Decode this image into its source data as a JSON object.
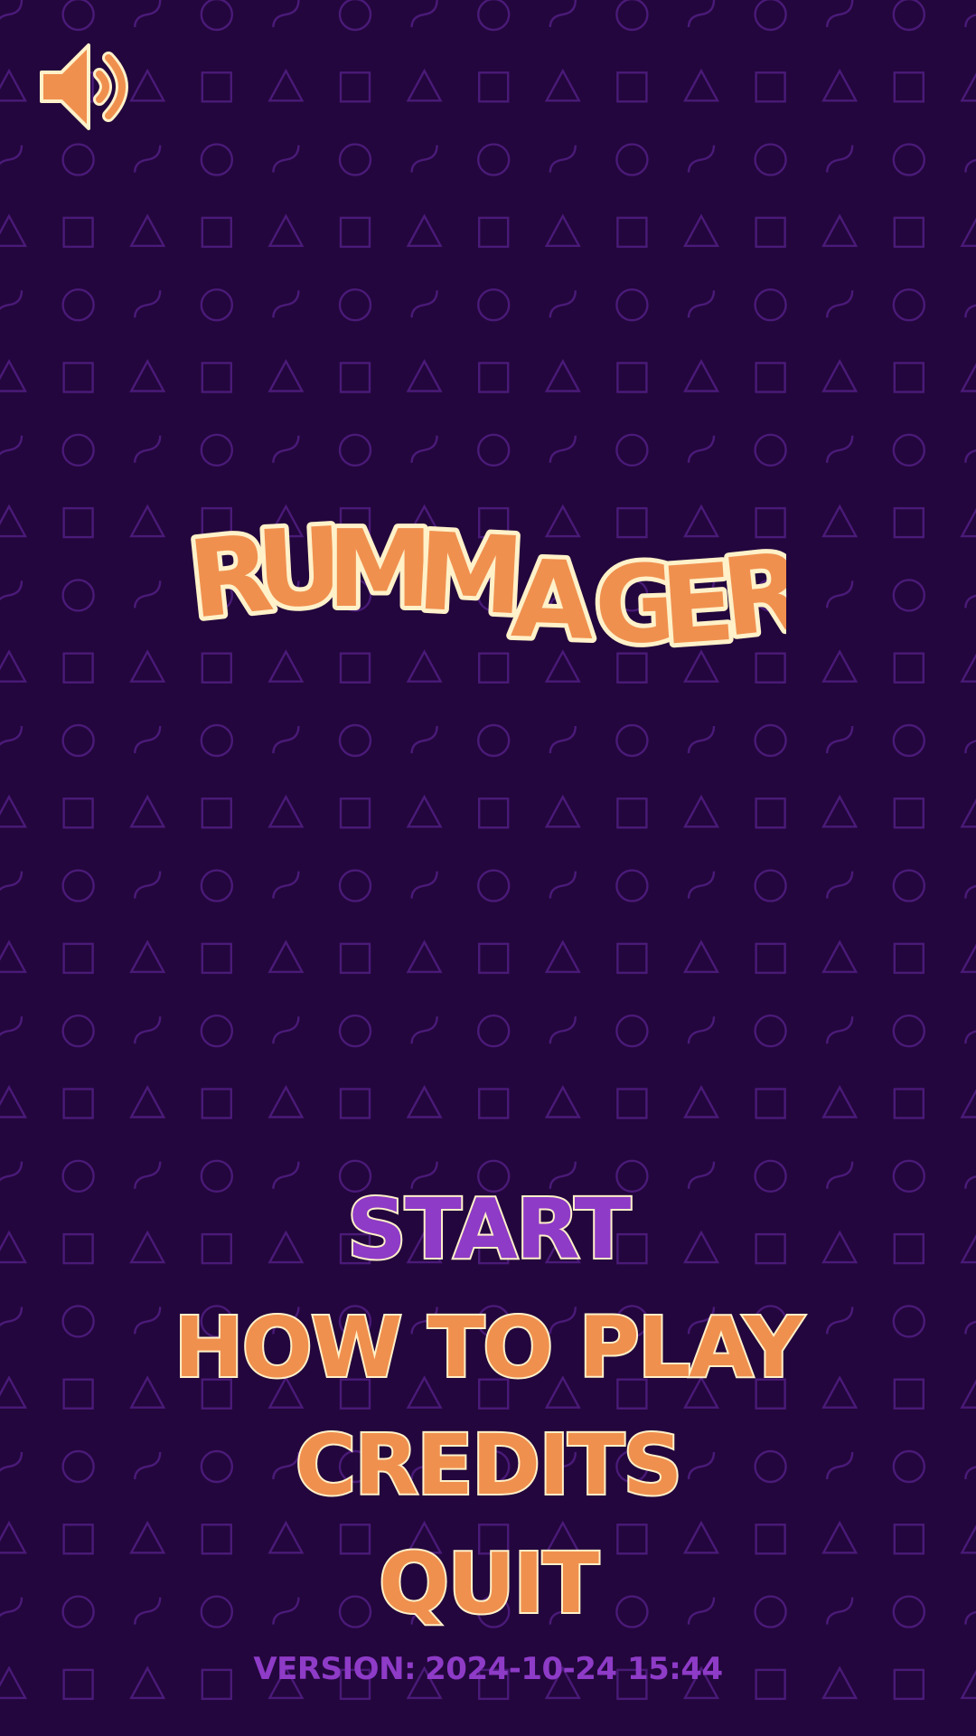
{
  "game": {
    "title": "RUMMAGER"
  },
  "sound": {
    "icon": "speaker-volume-icon",
    "state": "on"
  },
  "menu": {
    "start_label": "START",
    "how_to_play_label": "HOW TO PLAY",
    "credits_label": "CREDITS",
    "quit_label": "QUIT",
    "selected": "START"
  },
  "footer": {
    "version_label": "VERSION:",
    "version_value": "2024-10-24 15:44"
  },
  "colors": {
    "background": "#23063d",
    "pattern_stroke": "#4a1a78",
    "menu_text": "#f0904f",
    "menu_selected": "#8e3bc7",
    "text_outline": "#fff1c9",
    "version_text": "#8e3bc7"
  },
  "background_pattern": {
    "shapes": [
      "triangle",
      "square",
      "circle",
      "wave"
    ]
  }
}
